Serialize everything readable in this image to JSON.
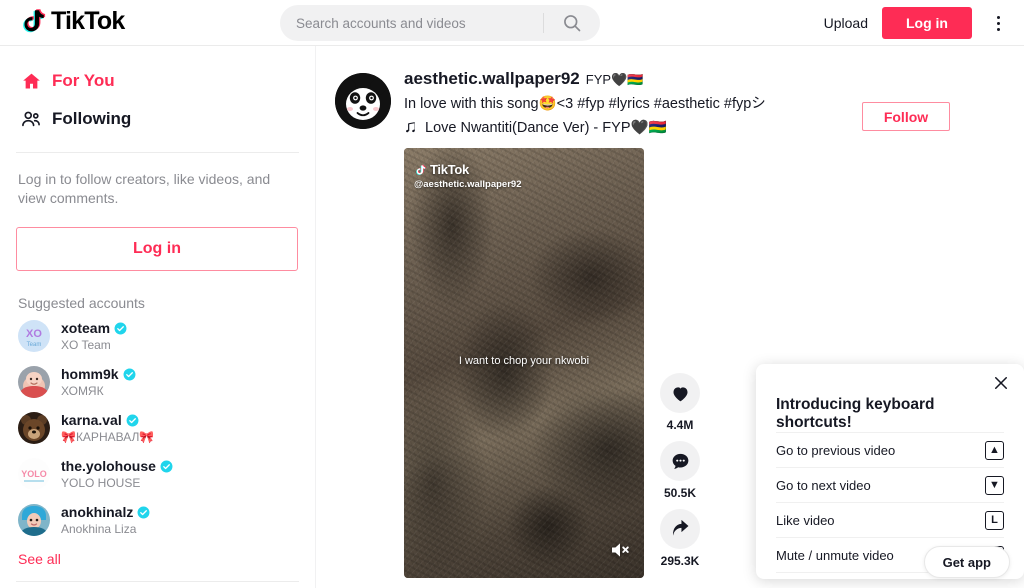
{
  "brand": {
    "name": "TikTok",
    "accent": "#fe2c55",
    "cyan": "#25f4ee"
  },
  "header": {
    "search": {
      "placeholder": "Search accounts and videos",
      "value": "",
      "icon": "search-icon"
    },
    "upload_label": "Upload",
    "login_label": "Log in",
    "menu_icon": "kebab-menu-icon"
  },
  "sidebar": {
    "nav": [
      {
        "label": "For You",
        "icon": "home-icon",
        "active": true
      },
      {
        "label": "Following",
        "icon": "people-icon",
        "active": false
      }
    ],
    "login_prompt": "Log in to follow creators, like videos, and view comments.",
    "login_label": "Log in",
    "suggested_label": "Suggested accounts",
    "accounts": [
      {
        "name": "xoteam",
        "subtitle": "XO Team",
        "verified": true
      },
      {
        "name": "homm9k",
        "subtitle": "ХОМЯК",
        "verified": true
      },
      {
        "name": "karna.val",
        "subtitle": "🎀КАРНАВАЛ🎀",
        "verified": true
      },
      {
        "name": "the.yolohouse",
        "subtitle": "YOLO HOUSE",
        "verified": true
      },
      {
        "name": "anokhinalz",
        "subtitle": "Anokhina Liza",
        "verified": true
      }
    ],
    "see_all_label": "See all"
  },
  "post": {
    "username": "aesthetic.wallpaper92",
    "nickname": "FYP🖤🇲🇺",
    "caption": "In love with this song🤩<3 #fyp #lyrics #aesthetic #fypシ",
    "music_icon": "music-note-icon",
    "music": "Love Nwantiti(Dance Ver) - FYP🖤🇲🇺",
    "follow_label": "Follow",
    "avatar_name": "panda-avatar",
    "video": {
      "watermark_brand": "TikTok",
      "watermark_handle": "@aesthetic.wallpaper92",
      "subtitle": "I want to chop your nkwobi",
      "mute_icon": "speaker-muted-icon",
      "muted": true
    },
    "actions": [
      {
        "icon": "heart-icon",
        "count": "4.4M",
        "name": "like-button"
      },
      {
        "icon": "comment-icon",
        "count": "50.5K",
        "name": "comment-button"
      },
      {
        "icon": "share-icon",
        "count": "295.3K",
        "name": "share-button"
      }
    ]
  },
  "shortcuts": {
    "title": "Introducing keyboard shortcuts!",
    "close_icon": "close-icon",
    "rows": [
      {
        "label": "Go to previous video",
        "key": "▲"
      },
      {
        "label": "Go to next video",
        "key": "▼"
      },
      {
        "label": "Like video",
        "key": "L"
      },
      {
        "label": "Mute / unmute video",
        "key": "M"
      }
    ]
  },
  "get_app_label": "Get app"
}
